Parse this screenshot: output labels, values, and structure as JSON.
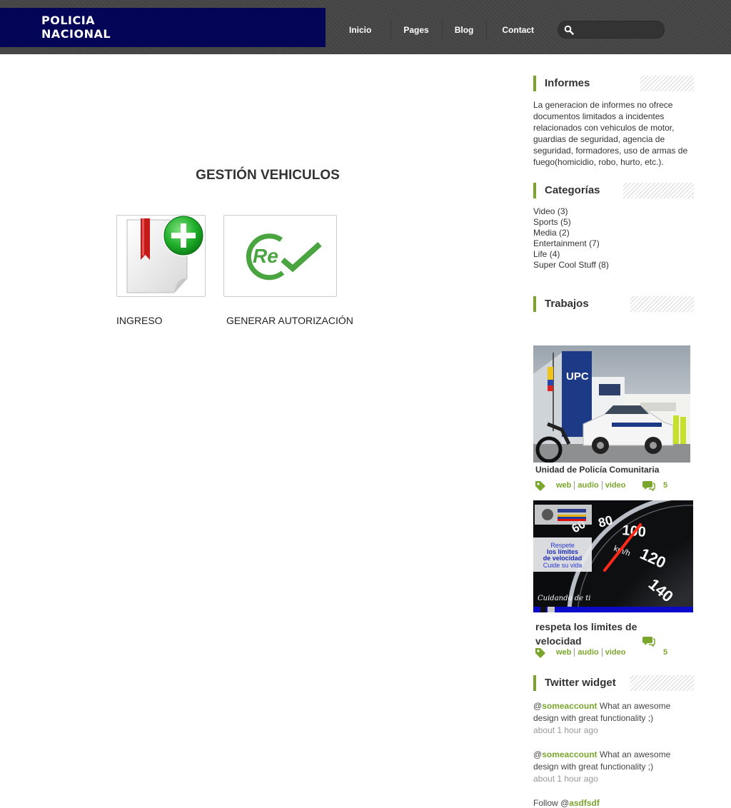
{
  "header": {
    "logo_line1": "POLICIA",
    "logo_line2": "NACIONAL",
    "nav": [
      "Inicio",
      "Pages",
      "Blog",
      "Contact"
    ],
    "search_placeholder": ""
  },
  "main": {
    "title": "GESTIÓN VEHICULOS",
    "tiles": [
      {
        "label": "INGRESO",
        "icon": "document-add-icon"
      },
      {
        "label": "GENERAR AUTORIZACIÓN",
        "icon": "re-check-icon"
      }
    ]
  },
  "sidebar": {
    "informes": {
      "title": "Informes",
      "text": "La generacion de informes no ofrece documentos limitados a incidentes relacionados con vehiculos de motor, guardias de seguridad, agencia de seguridad, formadores, uso de armas de fuego(homicidio, robo, hurto, etc.)."
    },
    "categorias": {
      "title": "Categorías",
      "items": [
        {
          "name": "Video",
          "count": "(3)"
        },
        {
          "name": "Sports",
          "count": "(5)"
        },
        {
          "name": "Media",
          "count": "(2)"
        },
        {
          "name": "Entertainment",
          "count": "(7)"
        },
        {
          "name": "Life",
          "count": "(4)"
        },
        {
          "name": "Super Cool Stuff",
          "count": "(8)"
        }
      ]
    },
    "trabajos": {
      "title": "Trabajos",
      "items": [
        {
          "title": "Unidad de Policía Comunitaria",
          "tags": [
            "web",
            "audio",
            "video"
          ],
          "comments": "5",
          "image_text": "UPC"
        },
        {
          "title_line1": "respeta los limites de",
          "title_line2": "velocidad",
          "tags": [
            "web",
            "audio",
            "video"
          ],
          "comments": "5",
          "sign_line1": "Respete",
          "sign_line2": "los límites",
          "sign_line3": "de velocidad",
          "sign_line4": "Cuide su vida",
          "caption": "Cuidando de ti",
          "gauge": [
            "60",
            "80",
            "100",
            "120",
            "140"
          ],
          "unit": "km/h"
        }
      ]
    },
    "twitter": {
      "title": "Twitter widget",
      "tweets": [
        {
          "at": "@",
          "account": "someaccount",
          "text": " What an awesome",
          "text2": "design with great functionality ;)",
          "time": "about 1 hour ago"
        },
        {
          "at": "@",
          "account": "someaccount",
          "text": " What an awesome",
          "text2": "design with great functionality ;)",
          "time": "about 1 hour ago"
        }
      ],
      "follow_prefix": "Follow @",
      "follow_account": "asdfsdf"
    }
  },
  "colors": {
    "accent": "#7aa62d",
    "logo_bg": "#050558",
    "header_bg": "#474747"
  }
}
